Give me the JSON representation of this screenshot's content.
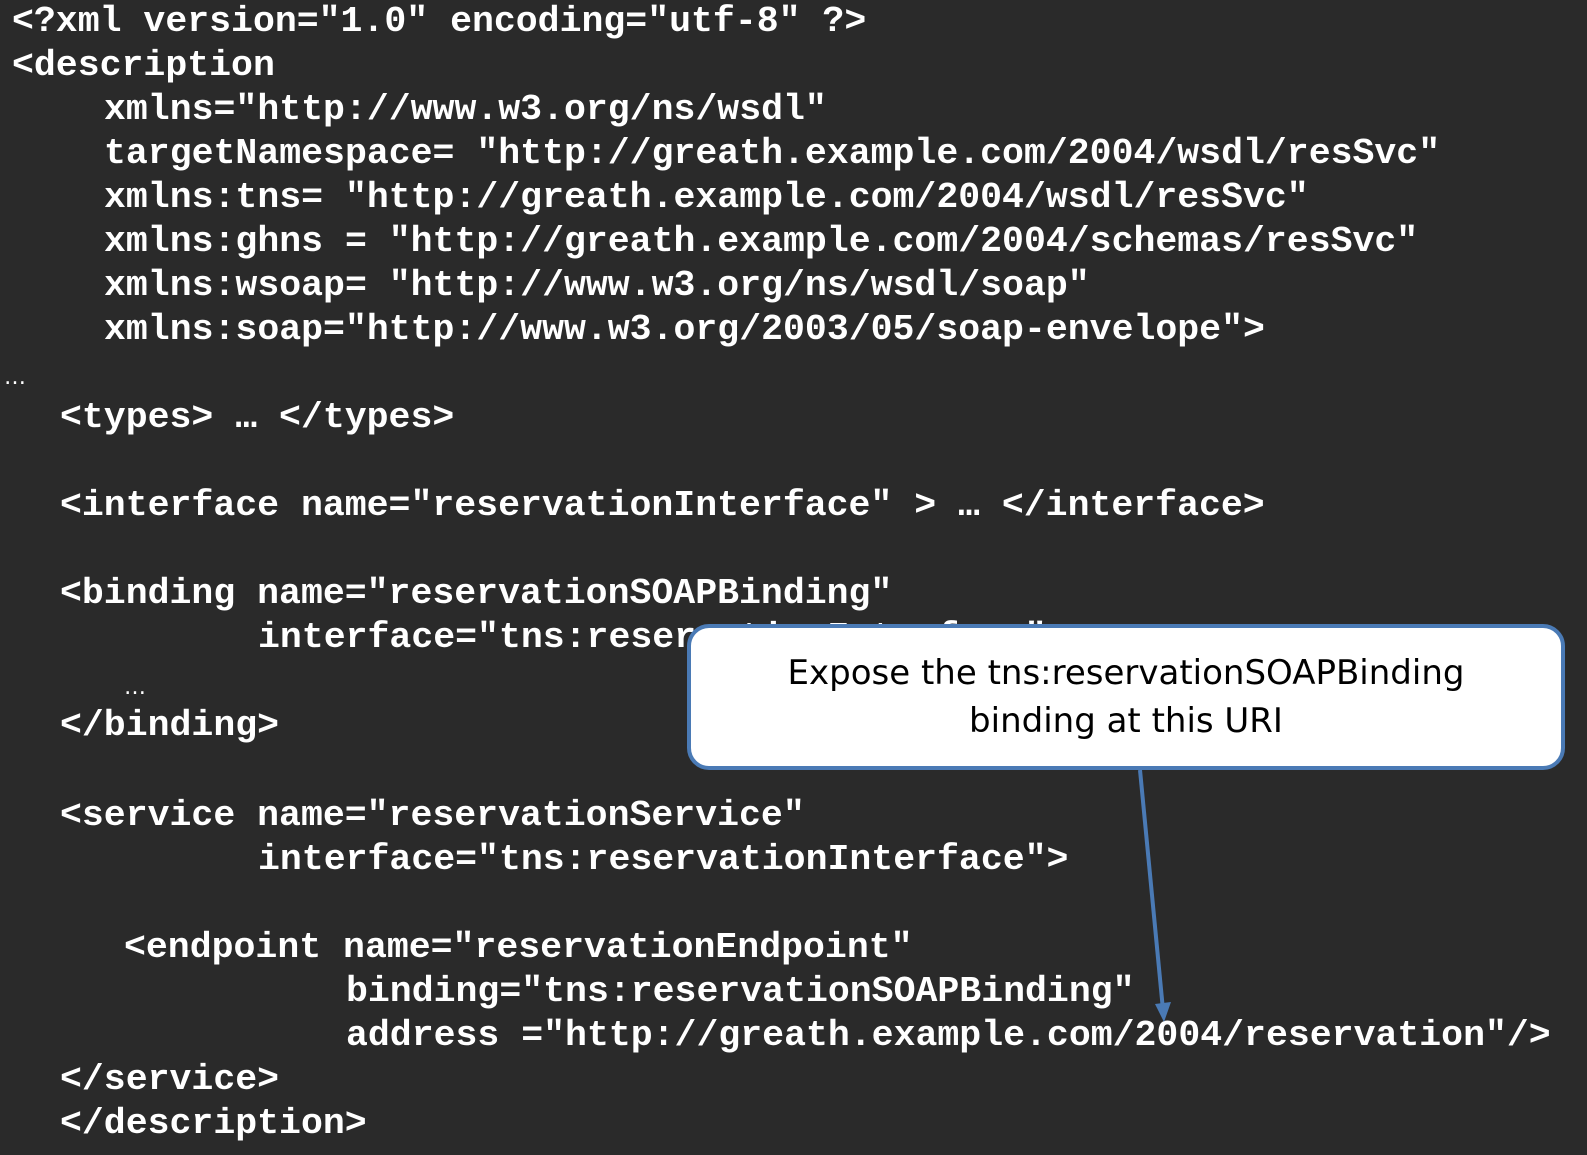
{
  "code": {
    "xml_decl": "<?xml version=\"1.0\" encoding=\"utf-8\" ?>",
    "desc_open": "<description",
    "xmlns": "xmlns=\"http://www.w3.org/ns/wsdl\"",
    "target_ns": "targetNamespace= \"http://greath.example.com/2004/wsdl/resSvc\"",
    "xmlns_tns": "xmlns:tns= \"http://greath.example.com/2004/wsdl/resSvc\"",
    "xmlns_ghns": "xmlns:ghns = \"http://greath.example.com/2004/schemas/resSvc\"",
    "xmlns_wsoap": "xmlns:wsoap= \"http://www.w3.org/ns/wsdl/soap\"",
    "xmlns_soap": "xmlns:soap=\"http://www.w3.org/2003/05/soap-envelope\">",
    "ellipsis_1": "…",
    "types": "<types> … </types>",
    "interface": "<interface name=\"reservationInterface\" > … </interface>",
    "binding_open": "<binding name=\"reservationSOAPBinding\"",
    "binding_interface": "interface=\"tns:reservationInterface\"",
    "ellipsis_2": "…",
    "binding_close": "</binding>",
    "service_open": "<service name=\"reservationService\"",
    "service_interface": "interface=\"tns:reservationInterface\">",
    "endpoint_open": "<endpoint name=\"reservationEndpoint\"",
    "endpoint_binding": "binding=\"tns:reservationSOAPBinding\"",
    "endpoint_address": "address =\"http://greath.example.com/2004/reservation\"/>",
    "service_close": "</service>",
    "desc_close": "</description>"
  },
  "callout": {
    "line1": "Expose the tns:reservationSOAPBinding",
    "line2": "binding at this URI"
  },
  "colors": {
    "background": "#2a2a2a",
    "code_text": "#ffffff",
    "callout_border": "#4a7ab5",
    "arrow": "#4a7ab5"
  }
}
